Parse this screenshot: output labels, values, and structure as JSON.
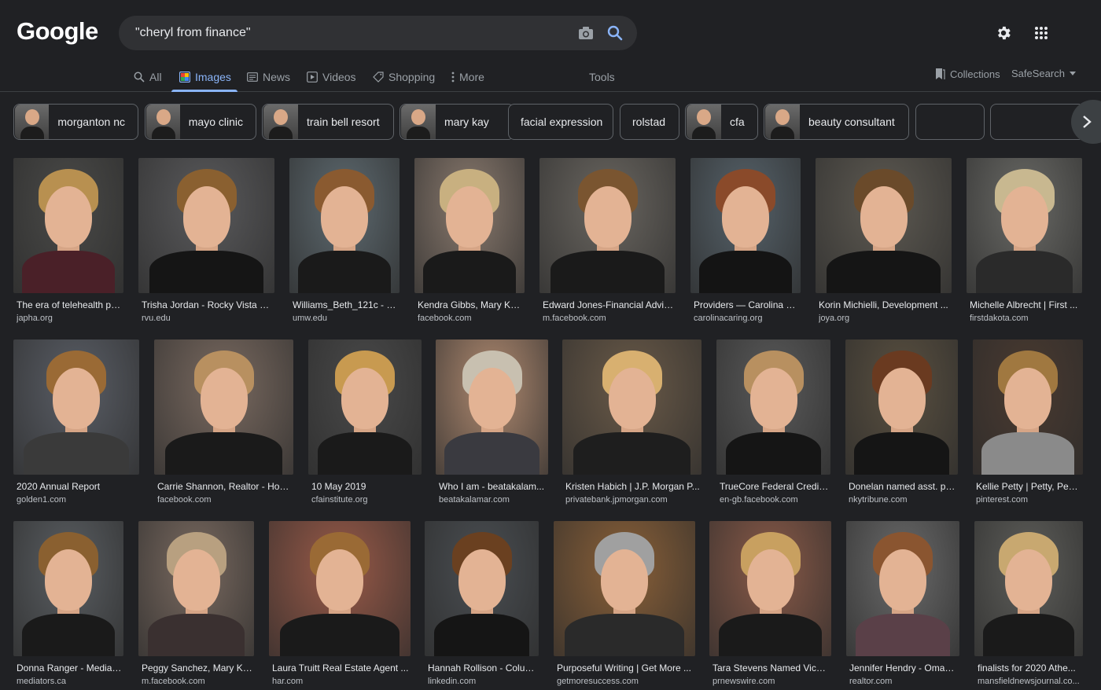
{
  "logo": "Google",
  "search": {
    "query": "\"cheryl from finance\""
  },
  "tabs": [
    {
      "label": "All",
      "icon": "search-icon"
    },
    {
      "label": "Images",
      "icon": "image-icon"
    },
    {
      "label": "News",
      "icon": "newspaper-icon"
    },
    {
      "label": "Videos",
      "icon": "play-icon"
    },
    {
      "label": "Shopping",
      "icon": "tag-icon"
    },
    {
      "label": "More",
      "icon": "more-vert-icon"
    }
  ],
  "tools_label": "Tools",
  "collections_label": "Collections",
  "safesearch_label": "SafeSearch",
  "chips": [
    {
      "label": "morganton nc",
      "thumb": true
    },
    {
      "label": "mayo clinic",
      "thumb": true
    },
    {
      "label": "train bell resort",
      "thumb": true
    },
    {
      "label": "mary kay",
      "thumb": true
    },
    {
      "label": "facial expression",
      "thumb": false
    },
    {
      "label": "rolstad",
      "thumb": false
    },
    {
      "label": "cfa",
      "thumb": true
    },
    {
      "label": "beauty consultant",
      "thumb": true
    },
    {
      "label": "",
      "thumb": false
    },
    {
      "label": "",
      "thumb": false
    }
  ],
  "results": [
    {
      "title": "The era of telehealth ph...",
      "source": "japha.org",
      "bg": "#4a4a48",
      "hair": "#b89050",
      "body": "#4a2028"
    },
    {
      "title": "Trisha Jordan - Rocky Vista U...",
      "source": "rvu.edu",
      "bg": "#5a5a5c",
      "hair": "#8a6030",
      "body": "#151515"
    },
    {
      "title": "Williams_Beth_121c - D...",
      "source": "umw.edu",
      "bg": "#5e6a70",
      "hair": "#8a5a30",
      "body": "#1a1a1a"
    },
    {
      "title": "Kendra Gibbs, Mary Kay...",
      "source": "facebook.com",
      "bg": "#8a7a6e",
      "hair": "#c8b080",
      "body": "#1a1a1a"
    },
    {
      "title": "Edward Jones-Financial Advis...",
      "source": "m.facebook.com",
      "bg": "#6a6660",
      "hair": "#7a5530",
      "body": "#1a1a1a"
    },
    {
      "title": "Providers — Carolina C...",
      "source": "carolinacaring.org",
      "bg": "#56626a",
      "hair": "#8a4a2a",
      "body": "#141414"
    },
    {
      "title": "Korin Michielli, Development ...",
      "source": "joya.org",
      "bg": "#5e5a52",
      "hair": "#6a4a2a",
      "body": "#151515"
    },
    {
      "title": "Michelle Albrecht | First ...",
      "source": "firstdakota.com",
      "bg": "#6a6a66",
      "hair": "#c8b890",
      "body": "#2a2a2a"
    },
    {
      "title": "2020 Annual Report",
      "source": "golden1.com",
      "bg": "#5a5e66",
      "hair": "#9a6a35",
      "body": "#3a3a3a"
    },
    {
      "title": "Carrie Shannon, Realtor - Hom...",
      "source": "facebook.com",
      "bg": "#7a6a60",
      "hair": "#b89060",
      "body": "#1a1a1a"
    },
    {
      "title": "10 May 2019",
      "source": "cfainstitute.org",
      "bg": "#4a4a4a",
      "hair": "#c89a50",
      "body": "#1a1a1a"
    },
    {
      "title": "Who I am - beatakalam...",
      "source": "beatakalamar.com",
      "bg": "#b08a70",
      "hair": "#c8c0b0",
      "body": "#3a3a40"
    },
    {
      "title": "Kristen Habich | J.P. Morgan P...",
      "source": "privatebank.jpmorgan.com",
      "bg": "#6a5a48",
      "hair": "#d8b070",
      "body": "#1e1e1e"
    },
    {
      "title": "TrueCore Federal Credit ...",
      "source": "en-gb.facebook.com",
      "bg": "#5a5a5a",
      "hair": "#b89060",
      "body": "#151515"
    },
    {
      "title": "Donelan named asst. pri...",
      "source": "nkytribune.com",
      "bg": "#5a5040",
      "hair": "#6a3a20",
      "body": "#151515"
    },
    {
      "title": "Kellie Petty | Petty, Peo...",
      "source": "pinterest.com",
      "bg": "#4a3a30",
      "hair": "#a07840",
      "body": "#8a8a8a"
    },
    {
      "title": "Donna Ranger - Mediat...",
      "source": "mediators.ca",
      "bg": "#5a5e62",
      "hair": "#8a6030",
      "body": "#1a1a1a"
    },
    {
      "title": "Peggy Sanchez, Mary Ka...",
      "source": "m.facebook.com",
      "bg": "#7a6a60",
      "hair": "#b8a080",
      "body": "#3a3030"
    },
    {
      "title": "Laura Truitt Real Estate Agent ...",
      "source": "har.com",
      "bg": "#9a5a48",
      "hair": "#9a6a35",
      "body": "#1a1a1a"
    },
    {
      "title": "Hannah Rollison - Colum...",
      "source": "linkedin.com",
      "bg": "#4a4e52",
      "hair": "#6a4020",
      "body": "#151515"
    },
    {
      "title": "Purposeful Writing | Get More ...",
      "source": "getmoresuccess.com",
      "bg": "#8a6038",
      "hair": "#a0a0a0",
      "body": "#2a2a2a"
    },
    {
      "title": "Tara Stevens Named Vice ...",
      "source": "prnewswire.com",
      "bg": "#8a5a48",
      "hair": "#c8a060",
      "body": "#1a1a1a"
    },
    {
      "title": "Jennifer Hendry - Omah...",
      "source": "realtor.com",
      "bg": "#6a6a6a",
      "hair": "#8a5530",
      "body": "#5a4048"
    },
    {
      "title": "finalists for 2020 Athe...",
      "source": "mansfieldnewsjournal.co...",
      "bg": "#5e5e5a",
      "hair": "#c8a870",
      "body": "#1a1a1a"
    }
  ]
}
